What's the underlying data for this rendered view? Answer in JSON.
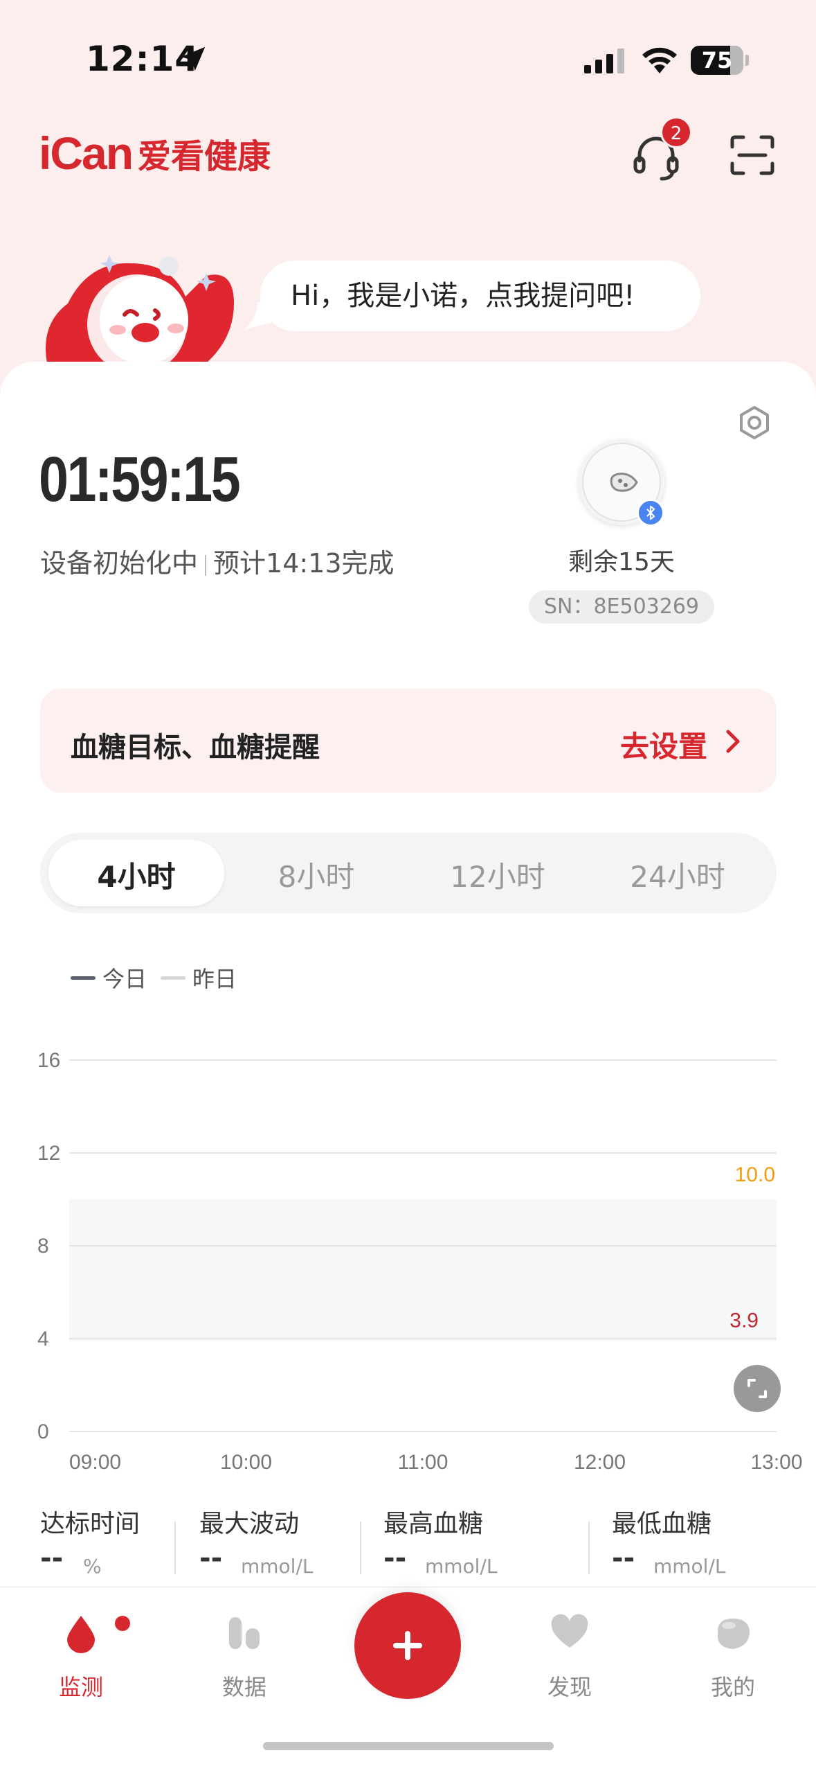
{
  "status_bar": {
    "time": "12:14",
    "battery": "75",
    "battery_level": 0.75
  },
  "header": {
    "logo_en": "iCan",
    "logo_cn": "爱看健康",
    "notification_count": "2"
  },
  "assistant": {
    "greeting": "Hi，我是小诺，点我提问吧!"
  },
  "device": {
    "countdown": "01:59:15",
    "status": "设备初始化中",
    "eta": "预计14:13完成",
    "remaining": "剩余15天",
    "serial": "SN：8E503269"
  },
  "goal_banner": {
    "title": "血糖目标、血糖提醒",
    "action": "去设置"
  },
  "range_tabs": [
    "4小时",
    "8小时",
    "12小时",
    "24小时"
  ],
  "active_range": "4小时",
  "legend": {
    "today": "今日",
    "yesterday": "昨日"
  },
  "chart_data": {
    "type": "line",
    "y_ticks": [
      "16",
      "12",
      "8",
      "4",
      "0"
    ],
    "x_ticks": [
      "09:00",
      "10:00",
      "11:00",
      "12:00",
      "13:00"
    ],
    "ylim": [
      0,
      16
    ],
    "target_range": {
      "low": 3.9,
      "high": 10.0,
      "low_label": "3.9",
      "high_label": "10.0"
    },
    "series": [
      {
        "name": "今日",
        "values": [],
        "color": "#5a5f6e"
      },
      {
        "name": "昨日",
        "values": [],
        "color": "#d8d8d8"
      }
    ],
    "grid": true
  },
  "stats": [
    {
      "label": "达标时间",
      "value": "--",
      "unit": "%"
    },
    {
      "label": "最大波动",
      "value": "--",
      "unit": "mmol/L"
    },
    {
      "label": "最高血糖",
      "value": "--",
      "unit": "mmol/L"
    },
    {
      "label": "最低血糖",
      "value": "--",
      "unit": "mmol/L"
    }
  ],
  "nav": [
    {
      "label": "监测",
      "icon": "blood-drop-icon"
    },
    {
      "label": "数据",
      "icon": "chart-bars-icon"
    },
    {
      "label": "发现",
      "icon": "heart-icon"
    },
    {
      "label": "我的",
      "icon": "profile-icon"
    }
  ],
  "colors": {
    "brand": "#d6262e",
    "high": "#f39c12",
    "low": "#c0262e",
    "background": "#fdeeee"
  }
}
